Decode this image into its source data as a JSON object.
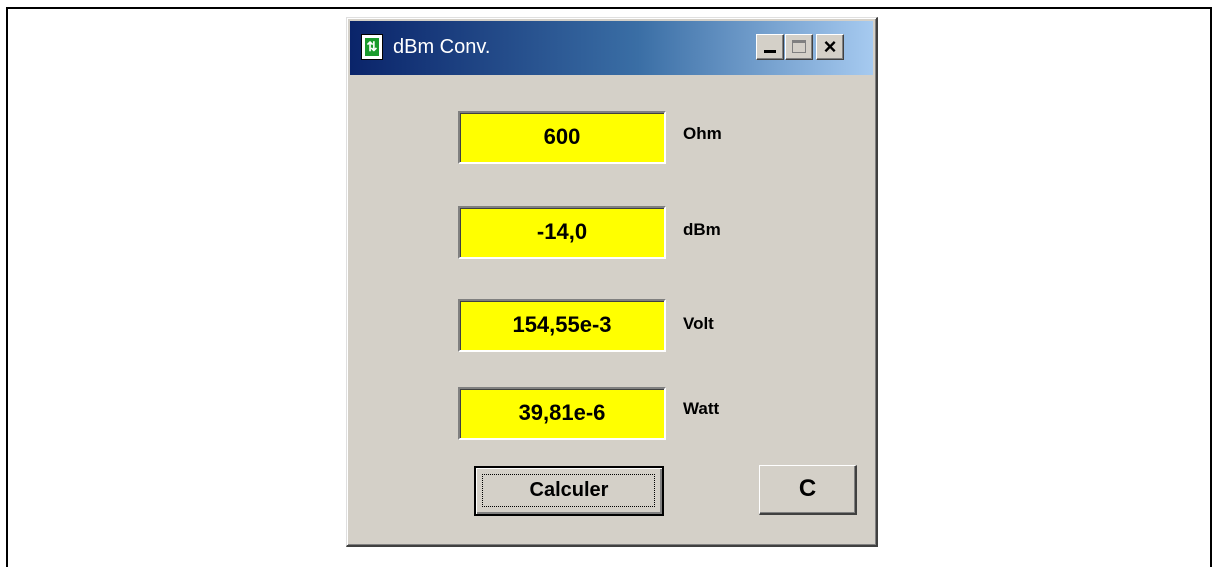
{
  "window": {
    "title": "dBm Conv."
  },
  "fields": [
    {
      "value": "600",
      "unit": "Ohm"
    },
    {
      "value": "-14,0",
      "unit": "dBm"
    },
    {
      "value": "154,55e-3",
      "unit": "Volt"
    },
    {
      "value": "39,81e-6",
      "unit": "Watt"
    }
  ],
  "buttons": {
    "calculate_label": "Calculer",
    "clear_label": "C"
  },
  "colors": {
    "field_bg": "#ffff00",
    "dialog_bg": "#d4d0c8",
    "titlebar": "#0a246a"
  },
  "icons": {
    "app": "dbm-converter-icon",
    "minimize": "minimize-icon",
    "maximize": "maximize-icon",
    "close": "close-icon"
  }
}
